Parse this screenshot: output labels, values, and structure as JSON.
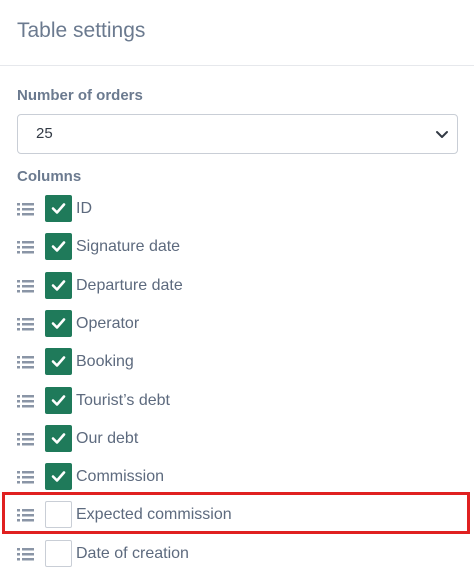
{
  "panel": {
    "title": "Table settings"
  },
  "orders": {
    "label": "Number of orders",
    "selected": "25"
  },
  "columns": {
    "label": "Columns",
    "items": [
      {
        "label": "ID",
        "checked": true
      },
      {
        "label": "Signature date",
        "checked": true
      },
      {
        "label": "Departure date",
        "checked": true
      },
      {
        "label": "Operator",
        "checked": true
      },
      {
        "label": "Booking",
        "checked": true
      },
      {
        "label": "Tourist’s debt",
        "checked": true
      },
      {
        "label": "Our debt",
        "checked": true
      },
      {
        "label": "Commission",
        "checked": true
      },
      {
        "label": "Expected commission",
        "checked": false
      },
      {
        "label": "Date of creation",
        "checked": false
      }
    ]
  },
  "colors": {
    "checkbox_checked": "#1f7a5a",
    "highlight": "#e02020",
    "text": "#5d6a7e"
  }
}
